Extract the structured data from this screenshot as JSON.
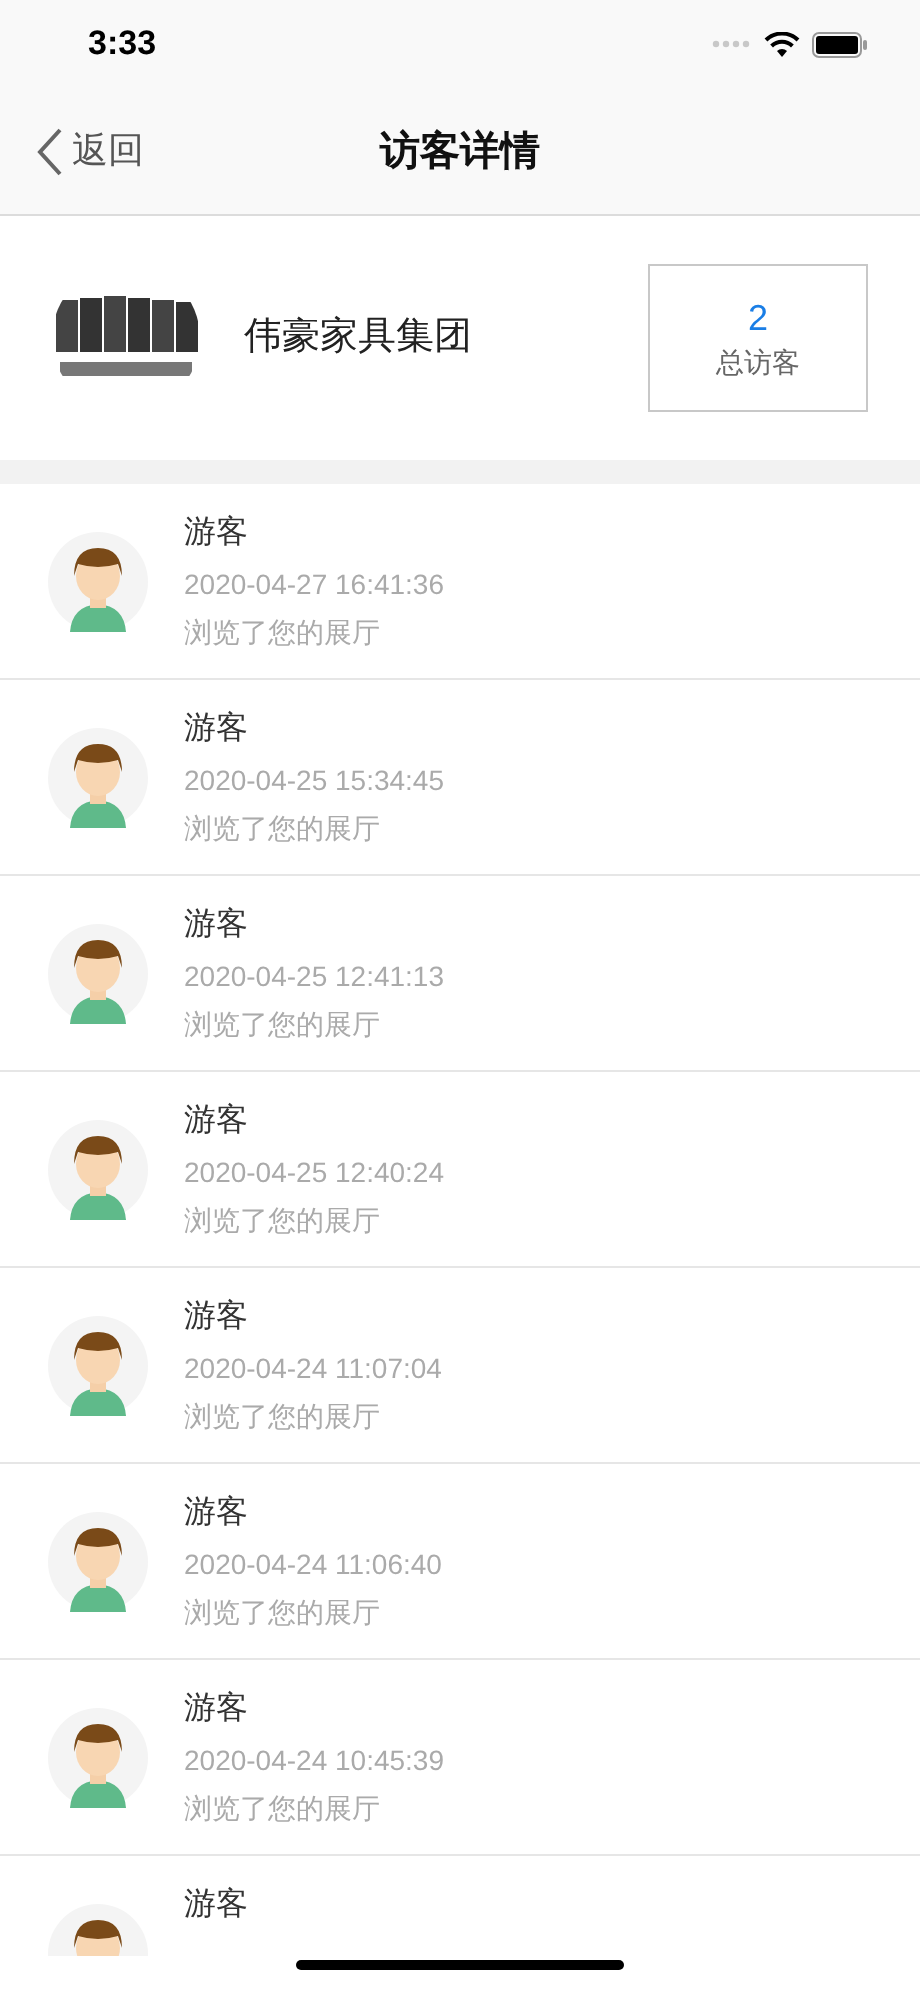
{
  "status_bar": {
    "time": "3:33"
  },
  "nav": {
    "back": "返回",
    "title": "访客详情"
  },
  "company": {
    "name": "伟豪家具集团",
    "total_count": "2",
    "total_label": "总访客"
  },
  "visitors": [
    {
      "name": "游客",
      "time": "2020-04-27 16:41:36",
      "action": "浏览了您的展厅"
    },
    {
      "name": "游客",
      "time": "2020-04-25 15:34:45",
      "action": "浏览了您的展厅"
    },
    {
      "name": "游客",
      "time": "2020-04-25 12:41:13",
      "action": "浏览了您的展厅"
    },
    {
      "name": "游客",
      "time": "2020-04-25 12:40:24",
      "action": "浏览了您的展厅"
    },
    {
      "name": "游客",
      "time": "2020-04-24 11:07:04",
      "action": "浏览了您的展厅"
    },
    {
      "name": "游客",
      "time": "2020-04-24 11:06:40",
      "action": "浏览了您的展厅"
    },
    {
      "name": "游客",
      "time": "2020-04-24 10:45:39",
      "action": "浏览了您的展厅"
    },
    {
      "name": "游客"
    }
  ]
}
